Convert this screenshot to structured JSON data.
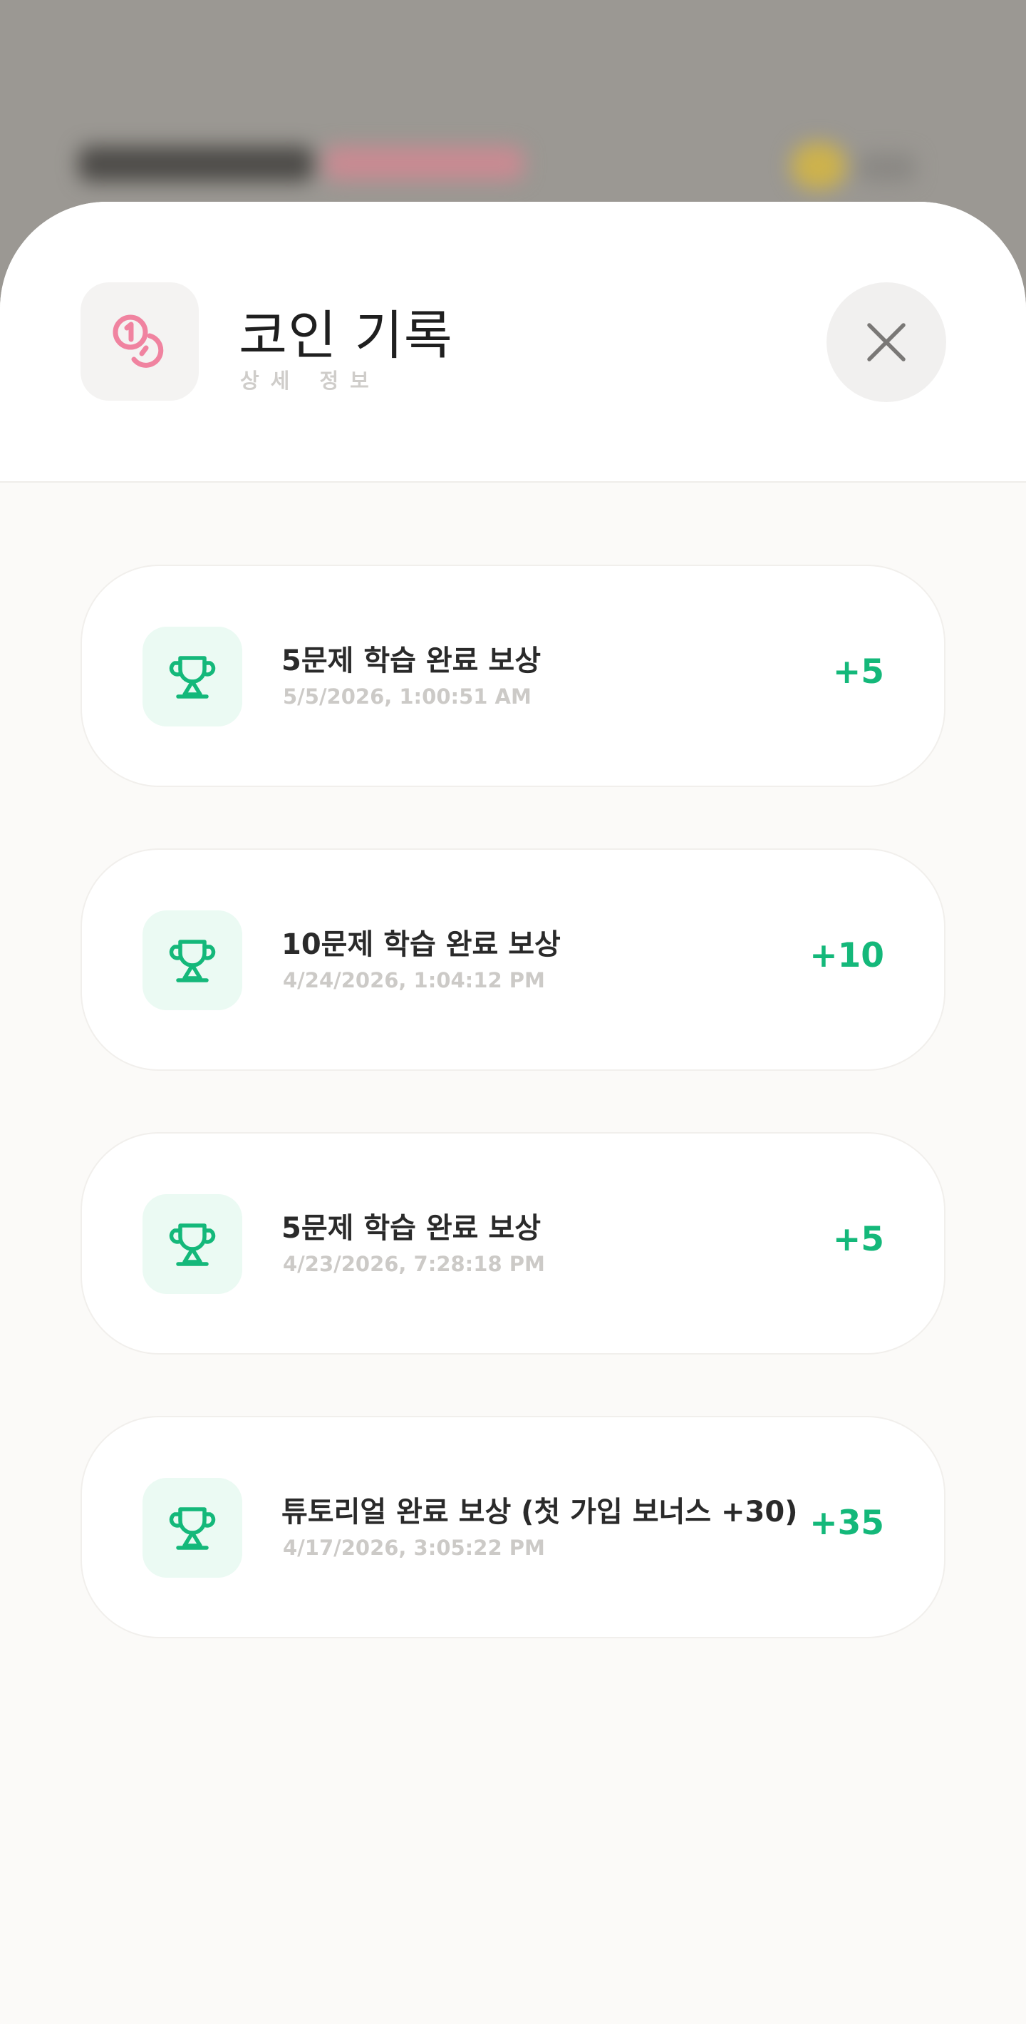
{
  "sheet": {
    "title": "코인 기록",
    "subtitle": "상세 정보",
    "header_icon": "coins-icon",
    "close_icon": "close-icon"
  },
  "history": [
    {
      "title": "5문제 학습 완료 보상",
      "date": "5/5/2026, 1:00:51 AM",
      "amount": "+5",
      "icon": "trophy-icon"
    },
    {
      "title": "10문제 학습 완료 보상",
      "date": "4/24/2026, 1:04:12 PM",
      "amount": "+10",
      "icon": "trophy-icon"
    },
    {
      "title": "5문제 학습 완료 보상",
      "date": "4/23/2026, 7:28:18 PM",
      "amount": "+5",
      "icon": "trophy-icon"
    },
    {
      "title": "튜토리얼 완료 보상 (첫 가입 보너스 +30)",
      "date": "4/17/2026, 3:05:22 PM",
      "amount": "+35",
      "icon": "trophy-icon"
    }
  ],
  "colors": {
    "accent_green": "#14b87a",
    "coin_pink": "#f083a0",
    "overlay": "#9b9893"
  }
}
